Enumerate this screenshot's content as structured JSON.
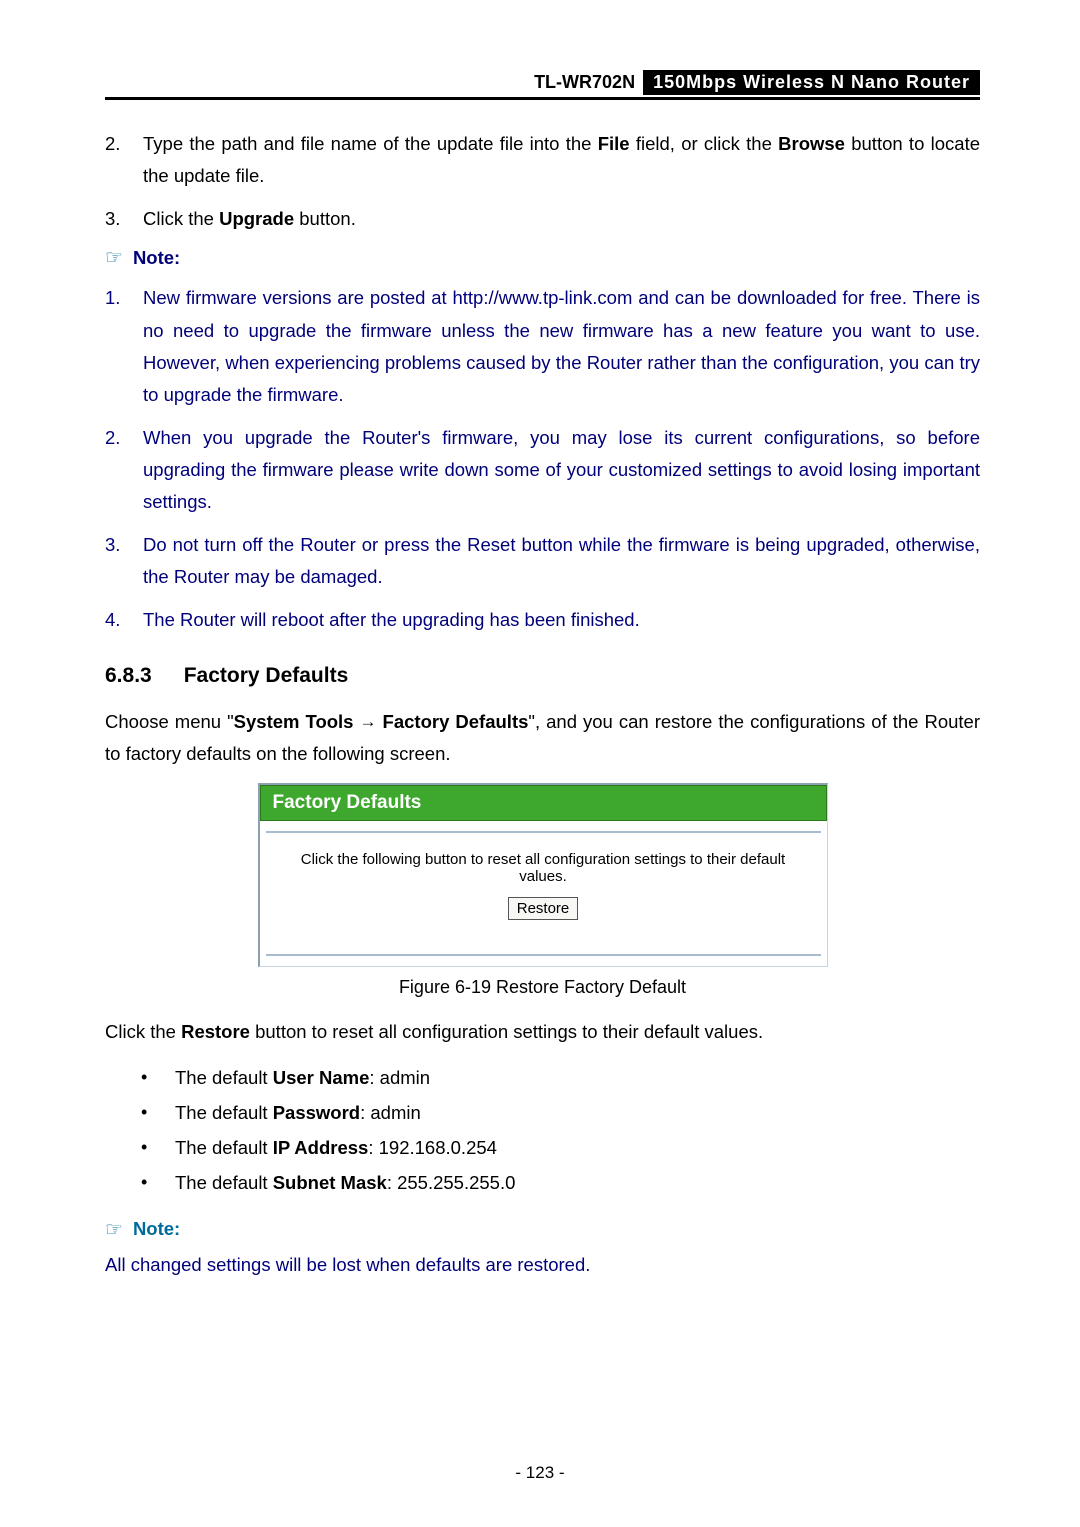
{
  "header": {
    "model": "TL-WR702N",
    "desc": "150Mbps  Wireless  N  Nano  Router"
  },
  "topList": {
    "item2_marker": "2.",
    "item2_pre": "Type the path and file name of the update file into the ",
    "item2_b1": "File",
    "item2_mid": " field, or click the ",
    "item2_b2": "Browse",
    "item2_post": " button to locate the update file.",
    "item3_marker": "3.",
    "item3_pre": "Click the ",
    "item3_b1": "Upgrade",
    "item3_post": " button."
  },
  "note1": {
    "label": "Note:"
  },
  "notes": {
    "n1_marker": "1.",
    "n1": "New firmware versions are posted at http://www.tp-link.com and can be downloaded for free. There is no need to upgrade the firmware unless the new firmware has a new feature you want to use. However, when experiencing problems caused by the Router rather than the configuration, you can try to upgrade the firmware.",
    "n2_marker": "2.",
    "n2": "When you upgrade the Router's firmware, you may lose its current configurations, so before upgrading the firmware please write down some of your customized settings to avoid losing important settings.",
    "n3_marker": "3.",
    "n3": "Do not turn off the Router or press the Reset button while the firmware is being upgraded, otherwise, the Router may be damaged.",
    "n4_marker": "4.",
    "n4": "The Router will reboot after the upgrading has been finished."
  },
  "section": {
    "num": "6.8.3",
    "title": "Factory Defaults"
  },
  "intro": {
    "pre": "Choose menu \"",
    "b1": "System Tools",
    "arrow": "→",
    "b2": " Factory Defaults",
    "post": "\", and you can restore the configurations of the Router to factory defaults on the following screen."
  },
  "panel": {
    "title": "Factory Defaults",
    "body": "Click the following button to reset all configuration settings to their default values.",
    "button": "Restore"
  },
  "figcaption": "Figure 6-19 Restore Factory Default",
  "afterfig": {
    "pre": "Click the ",
    "b1": "Restore",
    "post": " button to reset all configuration settings to their default values."
  },
  "defaults": {
    "d1_pre": "The default ",
    "d1_b": "User Name",
    "d1_post": ": admin",
    "d2_pre": "The default ",
    "d2_b": "Password",
    "d2_post": ": admin",
    "d3_pre": "The default ",
    "d3_b": "IP Address",
    "d3_post": ": 192.168.0.254",
    "d4_pre": "The default ",
    "d4_b": "Subnet Mask",
    "d4_post": ": 255.255.255.0"
  },
  "note2": {
    "label": "Note:"
  },
  "footnote": "All changed settings will be lost when defaults are restored.",
  "pagenum": "- 123 -"
}
